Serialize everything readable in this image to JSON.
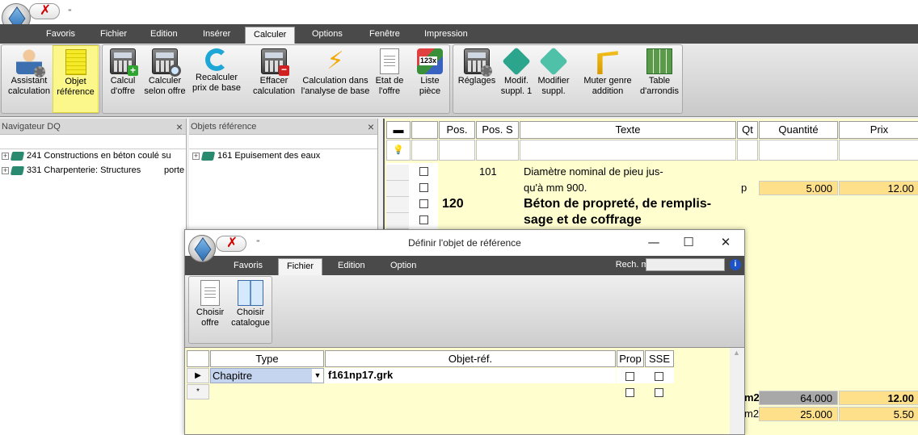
{
  "app": {
    "qat_arrow": "⁼"
  },
  "menu_tabs": [
    "Favoris",
    "Fichier",
    "Edition",
    "Insérer",
    "Calculer",
    "Options",
    "Fenêtre",
    "Impression"
  ],
  "ribbon": {
    "assistant": [
      "Assistant",
      "calculation"
    ],
    "objet_ref": [
      "Objet",
      "référence"
    ],
    "calcul_offre": [
      "Calcul",
      "d'offre"
    ],
    "calculer_selon": [
      "Calculer",
      "selon offre"
    ],
    "recalculer": [
      "Recalculer",
      "prix de base"
    ],
    "effacer": [
      "Effacer",
      "calculation"
    ],
    "calc_analyse": [
      "Calculation dans",
      "l'analyse de base"
    ],
    "etat_offre": [
      "Etat de",
      "l'offre"
    ],
    "liste_piece": [
      "Liste",
      "pièce"
    ],
    "reglages": [
      "Réglages",
      ""
    ],
    "modif_suppl": [
      "Modif.",
      "suppl. 1"
    ],
    "modifier_suppl": [
      "Modifier",
      "suppl."
    ],
    "muter": [
      "Muter genre",
      "addition"
    ],
    "table_arrondis": [
      "Table",
      "d'arrondis"
    ],
    "list_icon_text": "123x"
  },
  "nav_panel": {
    "title": "Navigateur DQ",
    "items": [
      {
        "label": "241 Constructions en béton coulé  su"
      },
      {
        "label": "331 Charpenterie: Structures",
        "extra": "porte"
      }
    ]
  },
  "obj_panel": {
    "title": "Objets référence",
    "items": [
      {
        "label": "161 Epuisement des eaux"
      }
    ]
  },
  "grid": {
    "headers": [
      "Pos.",
      "Pos. S",
      "Texte",
      "Qt",
      "Quantité",
      "Prix"
    ],
    "rows": {
      "r1_pos_s": "101",
      "r1_text_1": "Diamètre nominal de pieu jus-",
      "r1_text_2": "qu'à mm 900.",
      "r1_qt": "p",
      "r1_quantite": "5.000",
      "r1_prix": "12.00",
      "r2_pos": "120",
      "r2_text_1": "Béton de propreté, de remplis-",
      "r2_text_2": "sage et de coffrage",
      "r3_qt": "m2",
      "r3_quantite": "64.000",
      "r3_prix": "12.00",
      "r4_qt": "m2",
      "r4_quantite": "25.000",
      "r4_prix": "5.50"
    }
  },
  "dialog": {
    "title": "Définir l'objet de référence",
    "min": "—",
    "max": "☐",
    "close": "✕",
    "tabs": [
      "Favoris",
      "Fichier",
      "Edition",
      "Option"
    ],
    "rech_menu": "Rech. menu",
    "help": "i",
    "buttons": {
      "choisir_offre": [
        "Choisir",
        "offre"
      ],
      "choisir_catalogue": [
        "Choisir",
        "catalogue"
      ]
    },
    "grid": {
      "headers": [
        "Type",
        "Objet-réf.",
        "Prop",
        "SSE"
      ],
      "row1": {
        "marker": "▶",
        "type": "Chapitre",
        "objet": "f161np17.grk"
      },
      "row2": {
        "marker": "*"
      }
    }
  }
}
